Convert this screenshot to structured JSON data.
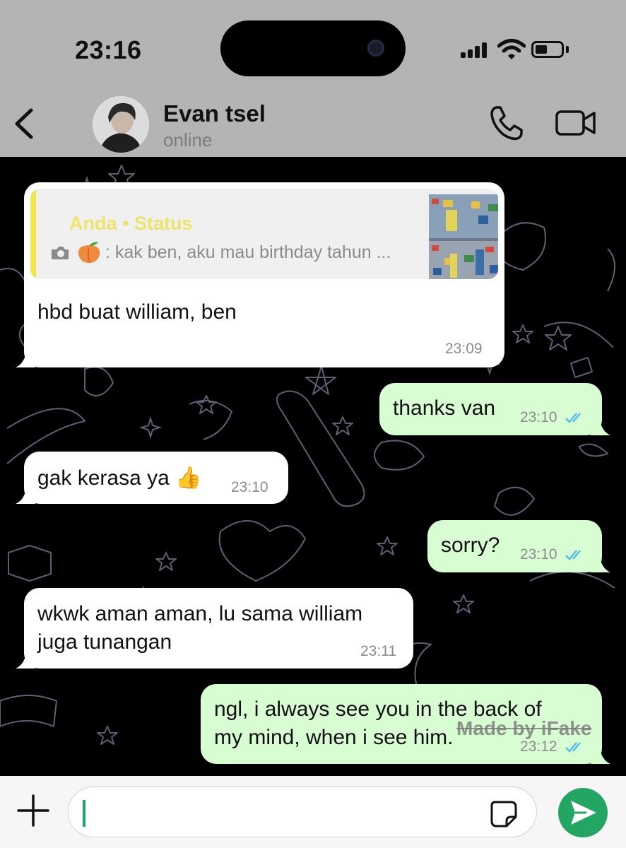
{
  "status_bar": {
    "time": "23:16"
  },
  "header": {
    "contact_name": "Evan tsel",
    "contact_status": "online",
    "icons": [
      "back-icon",
      "avatar",
      "phone-icon",
      "video-call-icon"
    ]
  },
  "messages": [
    {
      "direction": "in",
      "quote": {
        "title": "Anda • Status",
        "body": " : kak ben, aku mau birthday tahun ...",
        "icons": [
          "camera-icon",
          "peach-emoji"
        ]
      },
      "text": "hbd buat william, ben",
      "time": "23:09"
    },
    {
      "direction": "out",
      "text": "thanks van",
      "time": "23:10",
      "status": "read"
    },
    {
      "direction": "in",
      "text": "gak kerasa ya 👍",
      "time": "23:10"
    },
    {
      "direction": "out",
      "text": "sorry?",
      "time": "23:10",
      "status": "read"
    },
    {
      "direction": "in",
      "lines": [
        "wkwk aman aman, lu sama william",
        "juga tunangan"
      ],
      "time": "23:11"
    },
    {
      "direction": "out",
      "lines": [
        "ngl, i always see you in the back of",
        "my mind, when i see him."
      ],
      "time": "23:12",
      "status": "read"
    }
  ],
  "watermark": "Made by iFake",
  "colors": {
    "header_bg": "#b4b4b4",
    "incoming_bubble": "#ffffff",
    "outgoing_bubble": "#d9fdd3",
    "read_ticks": "#53bdeb",
    "quote_accent": "#f0e54a",
    "send_button": "#23a563"
  }
}
